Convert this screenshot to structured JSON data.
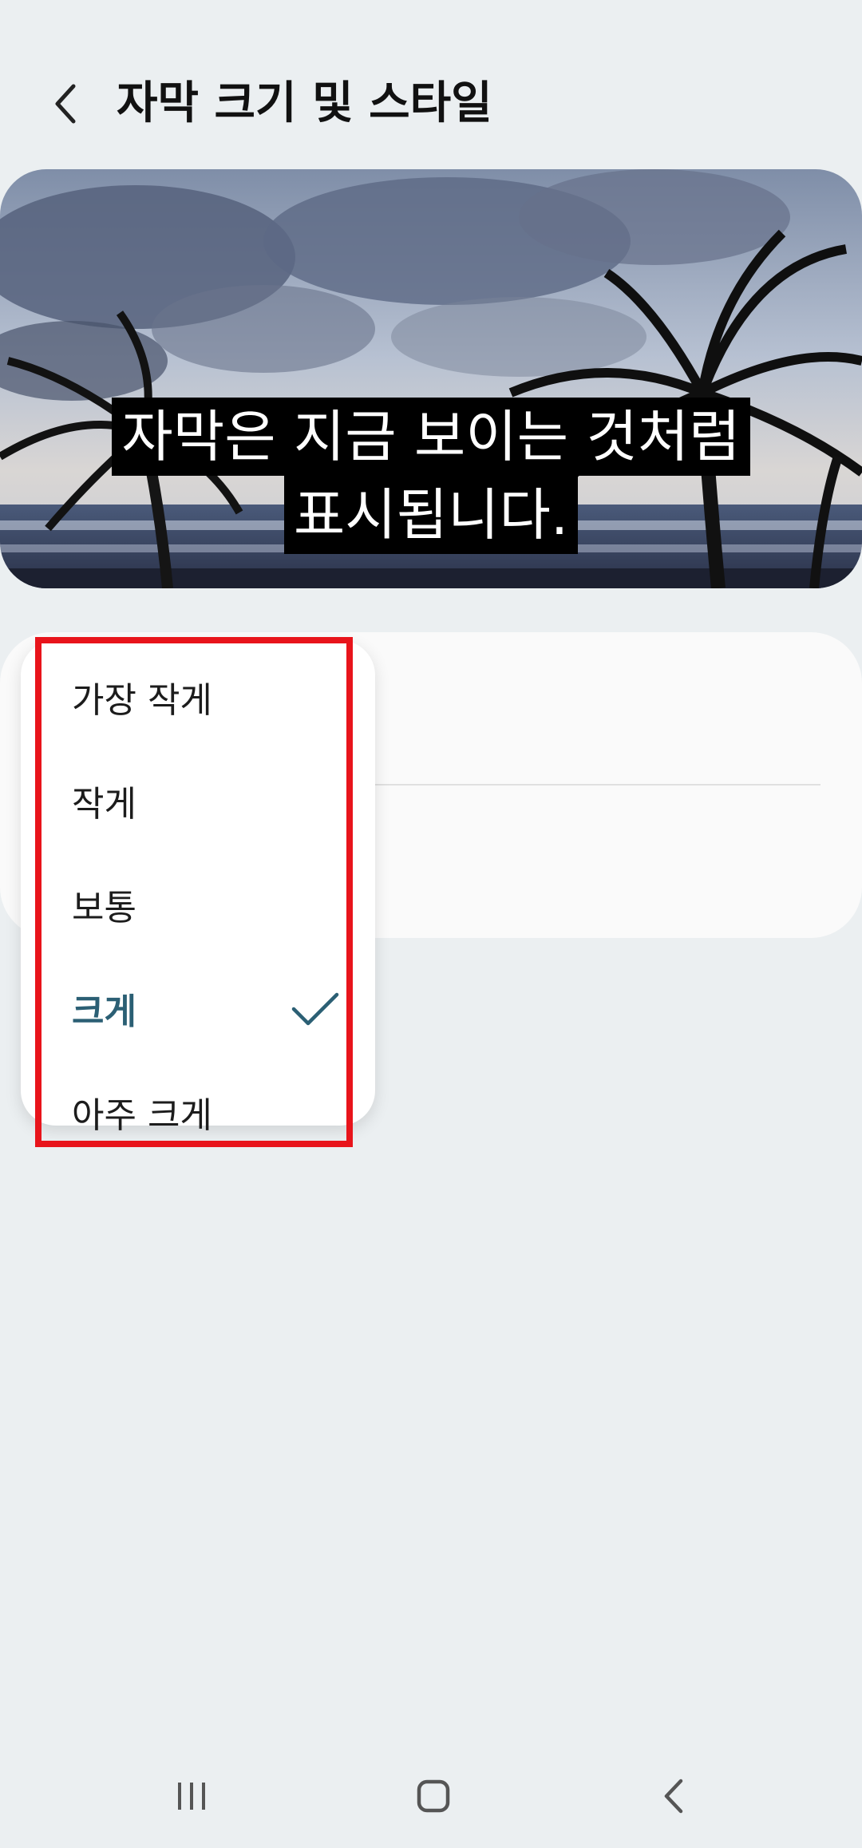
{
  "header": {
    "title": "자막 크기 및 스타일",
    "back_icon": "chevron-left-icon"
  },
  "preview": {
    "caption_lines": [
      "자막은 지금 보이는 것처럼",
      "표시됩니다."
    ]
  },
  "menu": {
    "items": [
      {
        "label": "가장 작게",
        "selected": false
      },
      {
        "label": "작게",
        "selected": false
      },
      {
        "label": "보통",
        "selected": false
      },
      {
        "label": "크게",
        "selected": true
      },
      {
        "label": "아주 크게",
        "selected": false
      }
    ],
    "check_icon": "checkmark-icon"
  },
  "nav_bar": {
    "recents_icon": "recents-icon",
    "home_icon": "home-icon",
    "back_icon": "back-icon"
  },
  "colors": {
    "background": "#ebeff1",
    "selected_text": "#2b5f74",
    "highlight": "#e8141b"
  }
}
